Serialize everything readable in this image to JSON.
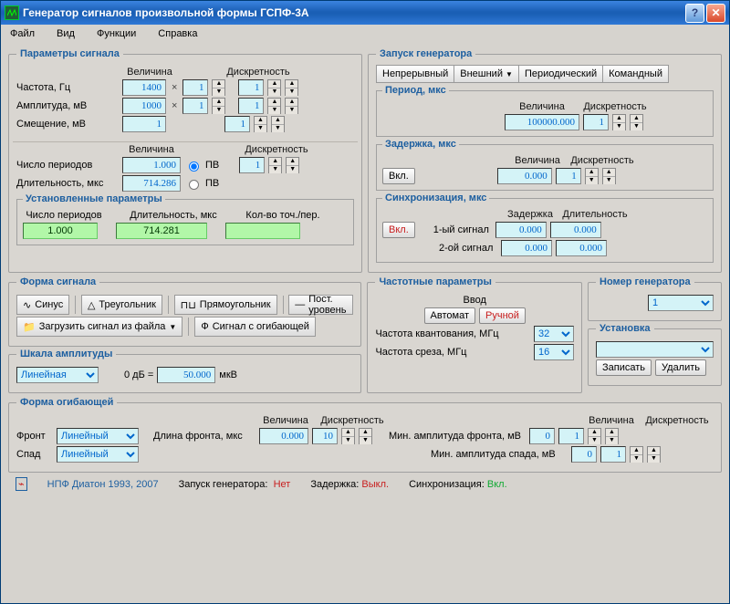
{
  "window": {
    "title": "Генератор сигналов произвольной формы ГСПФ-3А"
  },
  "menu": {
    "file": "Файл",
    "view": "Вид",
    "funcs": "Функции",
    "help": "Справка"
  },
  "signal": {
    "group": "Параметры сигнала",
    "col_value": "Величина",
    "col_disc": "Дискретность",
    "freq_label": "Частота, Гц",
    "freq_v": "1400",
    "freq_m": "1",
    "freq_d": "1",
    "amp_label": "Амплитуда, мВ",
    "amp_v": "1000",
    "amp_m": "1",
    "amp_d": "1",
    "off_label": "Смещение, мВ",
    "off_v": "1",
    "off_d": "1",
    "nper_label": "Число периодов",
    "nper_v": "1.000",
    "nper_pv": "ПВ",
    "nper_d": "1",
    "dur_label": "Длительность, мкс",
    "dur_v": "714.286",
    "dur_pv": "ПВ",
    "set_group": "Установленные параметры",
    "set_nper_label": "Число периодов",
    "set_nper": "1.000",
    "set_dur_label": "Длительность, мкс",
    "set_dur": "714.281",
    "set_ppp_label": "Кол-во точ./пер.",
    "set_ppp": ""
  },
  "gen": {
    "group": "Запуск генератора",
    "tabs": {
      "cont": "Непрерывный",
      "ext": "Внешний",
      "per": "Периодический",
      "cmd": "Командный"
    },
    "period": {
      "group": "Период, мкс",
      "col_value": "Величина",
      "col_disc": "Дискретность",
      "v": "100000.000",
      "d": "1"
    },
    "delay": {
      "group": "Задержка, мкс",
      "col_value": "Величина",
      "col_disc": "Дискретность",
      "btn": "Вкл.",
      "v": "0.000",
      "d": "1"
    },
    "sync": {
      "group": "Синхронизация, мкс",
      "btn": "Вкл.",
      "col_delay": "Задержка",
      "col_dur": "Длительность",
      "s1_lbl": "1-ый сигнал",
      "s1_delay": "0.000",
      "s1_dur": "0.000",
      "s2_lbl": "2-ой сигнал",
      "s2_delay": "0.000",
      "s2_dur": "0.000"
    }
  },
  "shape": {
    "group": "Форма сигнала",
    "sine": "Синус",
    "tri": "Треугольник",
    "rect": "Прямоугольник",
    "dc": "Пост. уровень",
    "load": "Загрузить сигнал  из файла",
    "env": "Сигнал с огибающей"
  },
  "ampscale": {
    "group": "Шкала амплитуды",
    "type": "Линейная",
    "db": "0 дБ =",
    "val": "50.000",
    "unit": "мкВ"
  },
  "freqpar": {
    "group": "Частотные параметры",
    "input_label": "Ввод",
    "auto": "Автомат",
    "manual": "Ручной",
    "fq_label": "Частота квантования, МГц",
    "fq": "32",
    "fc_label": "Частота среза, МГц",
    "fc": "16"
  },
  "gennum": {
    "group": "Номер генератора",
    "val": "1"
  },
  "install": {
    "group": "Установка",
    "write": "Записать",
    "del": "Удалить"
  },
  "envshape": {
    "group": "Форма огибающей",
    "col_value": "Величина",
    "col_disc": "Дискретность",
    "front_lbl": "Фронт",
    "front_type": "Линейный",
    "decay_lbl": "Спад",
    "decay_type": "Линейный",
    "front_len_lbl": "Длина фронта, мкс",
    "front_len": "0.000",
    "front_disc": "10",
    "min_front_lbl": "Мин. амплитуда фронта, мВ",
    "min_front": "0",
    "min_front_d": "1",
    "min_decay_lbl": "Мин. амплитуда спада, мВ",
    "min_decay": "0",
    "min_decay_d": "1"
  },
  "footer": {
    "brand": "НПФ Диатон 1993, 2007",
    "gen_lbl": "Запуск генератора:",
    "gen_val": "Нет",
    "delay_lbl": "Задержка:",
    "delay_val": "Выкл.",
    "sync_lbl": "Синхронизация:",
    "sync_val": "Вкл."
  }
}
